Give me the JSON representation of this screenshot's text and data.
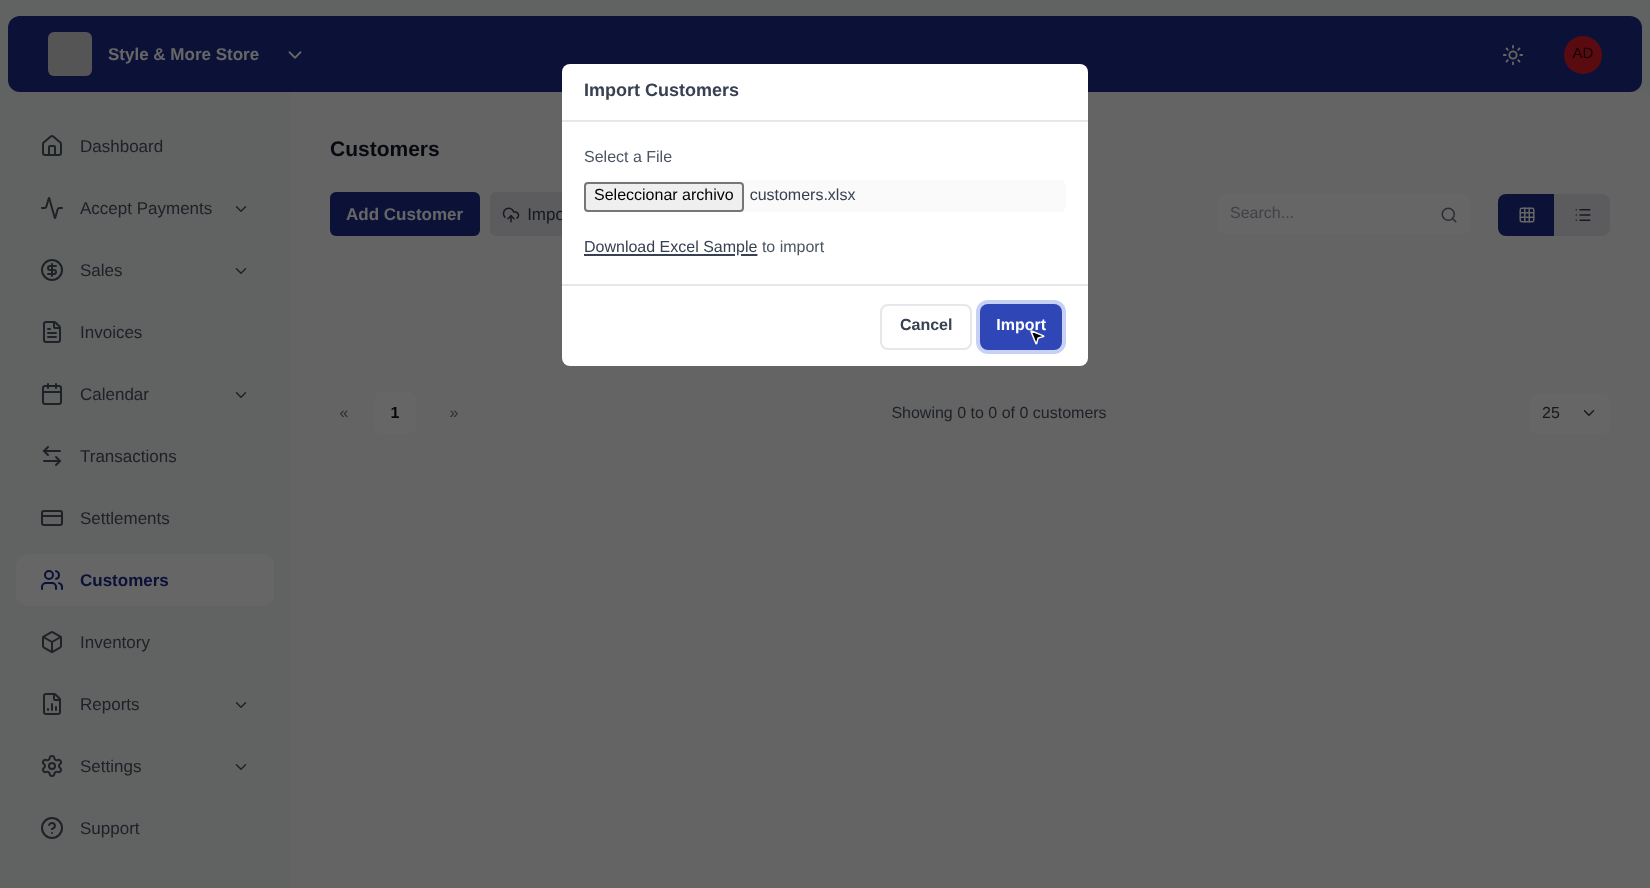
{
  "header": {
    "store_name": "Style & More Store",
    "avatar": "AD"
  },
  "sidebar": {
    "items": [
      {
        "label": "Dashboard",
        "has_submenu": false,
        "selected": false
      },
      {
        "label": "Accept Payments",
        "has_submenu": true,
        "selected": false
      },
      {
        "label": "Sales",
        "has_submenu": true,
        "selected": false
      },
      {
        "label": "Invoices",
        "has_submenu": false,
        "selected": false
      },
      {
        "label": "Calendar",
        "has_submenu": true,
        "selected": false
      },
      {
        "label": "Transactions",
        "has_submenu": false,
        "selected": false
      },
      {
        "label": "Settlements",
        "has_submenu": false,
        "selected": false
      },
      {
        "label": "Customers",
        "has_submenu": false,
        "selected": true
      },
      {
        "label": "Inventory",
        "has_submenu": false,
        "selected": false
      },
      {
        "label": "Reports",
        "has_submenu": true,
        "selected": false
      },
      {
        "label": "Settings",
        "has_submenu": true,
        "selected": false
      },
      {
        "label": "Support",
        "has_submenu": false,
        "selected": false
      }
    ]
  },
  "page": {
    "title": "Customers",
    "add_button": "Add Customer",
    "import_button": "Impo",
    "search": {
      "placeholder": "Search..."
    },
    "views": [
      {
        "kind": "grid",
        "selected": true
      },
      {
        "kind": "list",
        "selected": false
      }
    ],
    "pagination": {
      "first": "«",
      "page": "1",
      "last": "»",
      "summary": "Showing 0 to 0 of 0 customers",
      "page_size": "25"
    }
  },
  "modal": {
    "title": "Import Customers",
    "field_label": "Select a File",
    "file_button": "Seleccionar archivo",
    "file_name": "customers.xlsx",
    "link": "Download Excel Sample",
    "link_suffix": " to import",
    "buttons": [
      "Cancel",
      "Import"
    ]
  }
}
